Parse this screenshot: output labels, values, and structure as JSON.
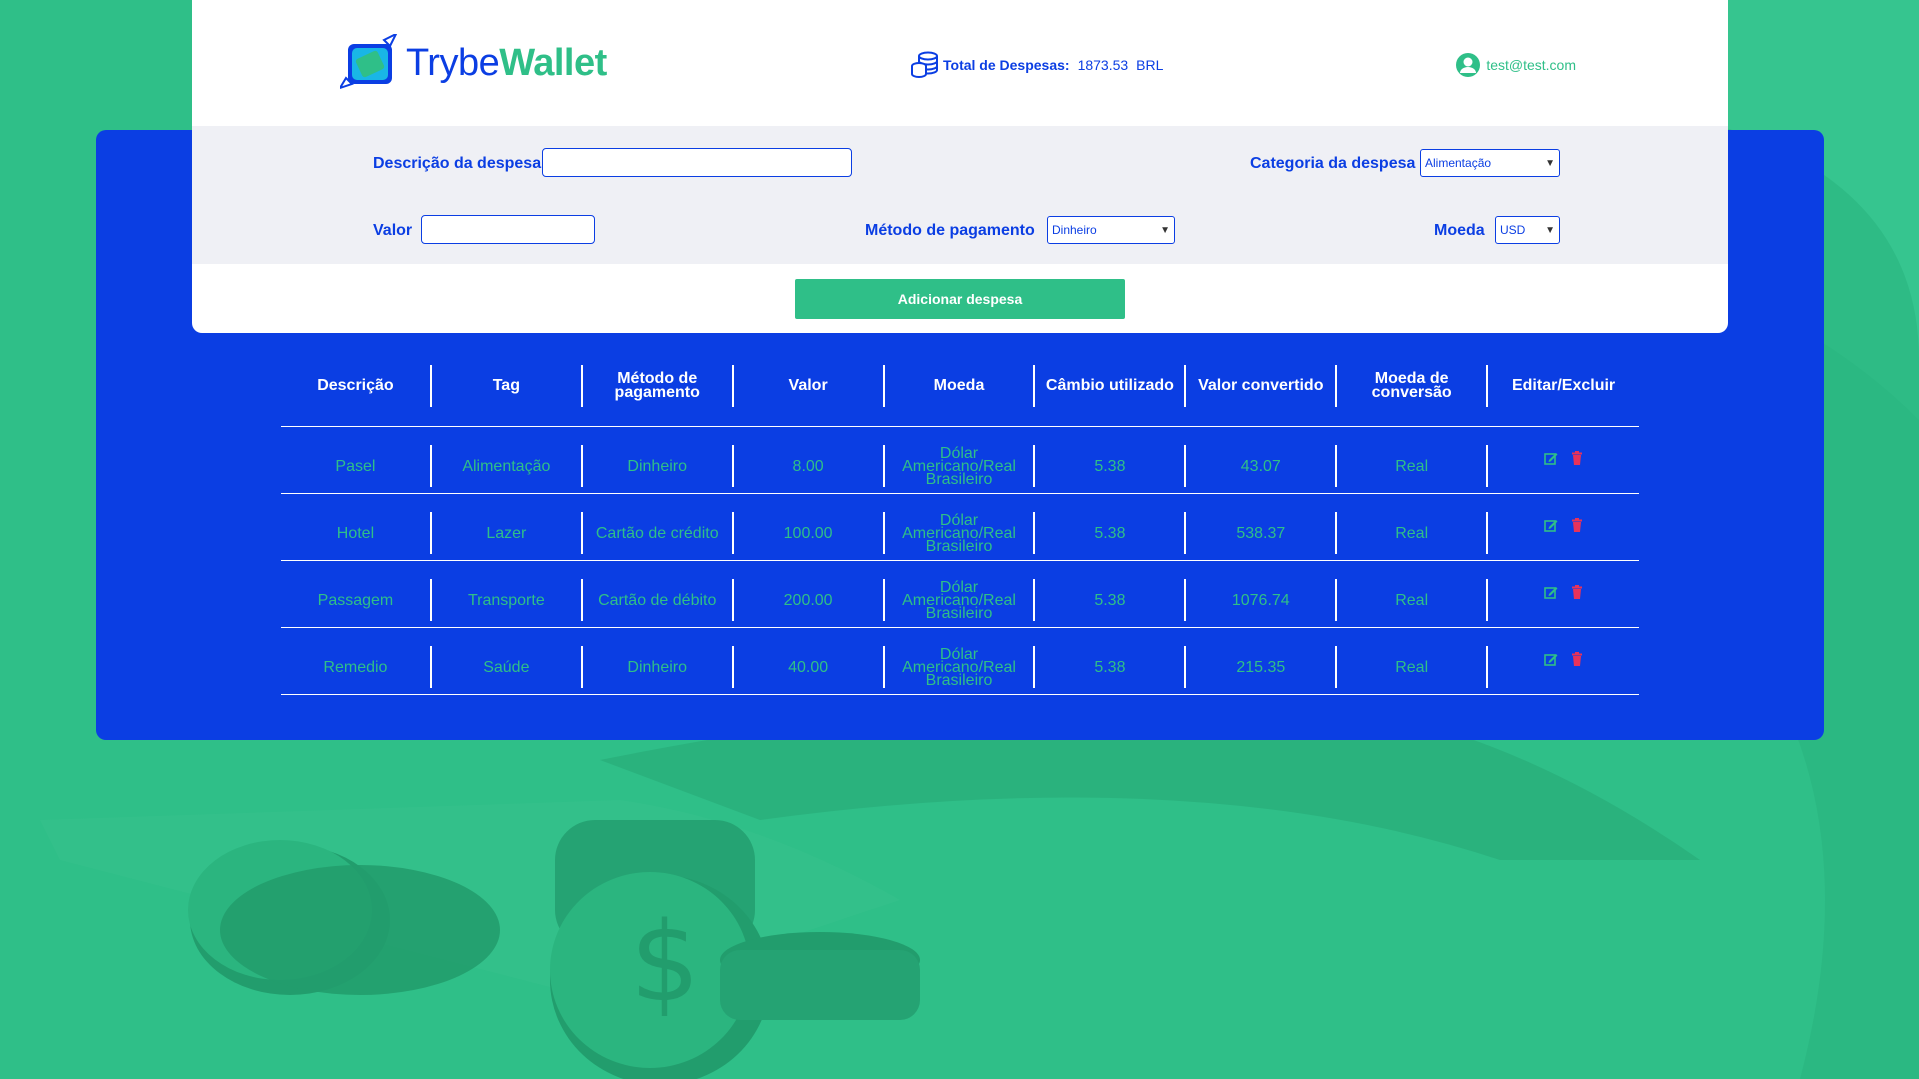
{
  "app": {
    "logo_trybe": "Trybe",
    "logo_wallet": "Wallet"
  },
  "header": {
    "total_label": "Total de Despesas:",
    "total_value": "1873.53",
    "total_currency": "BRL",
    "user_email": "test@test.com"
  },
  "form": {
    "description_label": "Descrição da despesa",
    "description_value": "",
    "category_label": "Categoria da despesa",
    "category_selected": "Alimentação",
    "value_label": "Valor",
    "value_value": "",
    "method_label": "Método de pagamento",
    "method_selected": "Dinheiro",
    "currency_label": "Moeda",
    "currency_selected": "USD",
    "add_button": "Adicionar despesa"
  },
  "table": {
    "headers": [
      "Descrição",
      "Tag",
      "Método de pagamento",
      "Valor",
      "Moeda",
      "Câmbio utilizado",
      "Valor convertido",
      "Moeda de conversão",
      "Editar/Excluir"
    ],
    "rows": [
      {
        "description": "Pasel",
        "tag": "Alimentação",
        "method": "Dinheiro",
        "value": "8.00",
        "currency": "Dólar Americano/Real Brasileiro",
        "rate": "5.38",
        "converted": "43.07",
        "conversion_currency": "Real"
      },
      {
        "description": "Hotel",
        "tag": "Lazer",
        "method": "Cartão de crédito",
        "value": "100.00",
        "currency": "Dólar Americano/Real Brasileiro",
        "rate": "5.38",
        "converted": "538.37",
        "conversion_currency": "Real"
      },
      {
        "description": "Passagem",
        "tag": "Transporte",
        "method": "Cartão de débito",
        "value": "200.00",
        "currency": "Dólar Americano/Real Brasileiro",
        "rate": "5.38",
        "converted": "1076.74",
        "conversion_currency": "Real"
      },
      {
        "description": "Remedio",
        "tag": "Saúde",
        "method": "Dinheiro",
        "value": "40.00",
        "currency": "Dólar Americano/Real Brasileiro",
        "rate": "5.38",
        "converted": "215.35",
        "conversion_currency": "Real"
      }
    ]
  },
  "colors": {
    "primary_blue": "#0b3ee3",
    "accent_green": "#2fbf88",
    "delete_red": "#e8325a",
    "form_grey": "#eff0f5"
  },
  "icons": {
    "logo": "wallet-logo-icon",
    "total": "coins-stack-icon",
    "user": "user-avatar-icon",
    "edit": "edit-icon",
    "delete": "trash-icon"
  }
}
